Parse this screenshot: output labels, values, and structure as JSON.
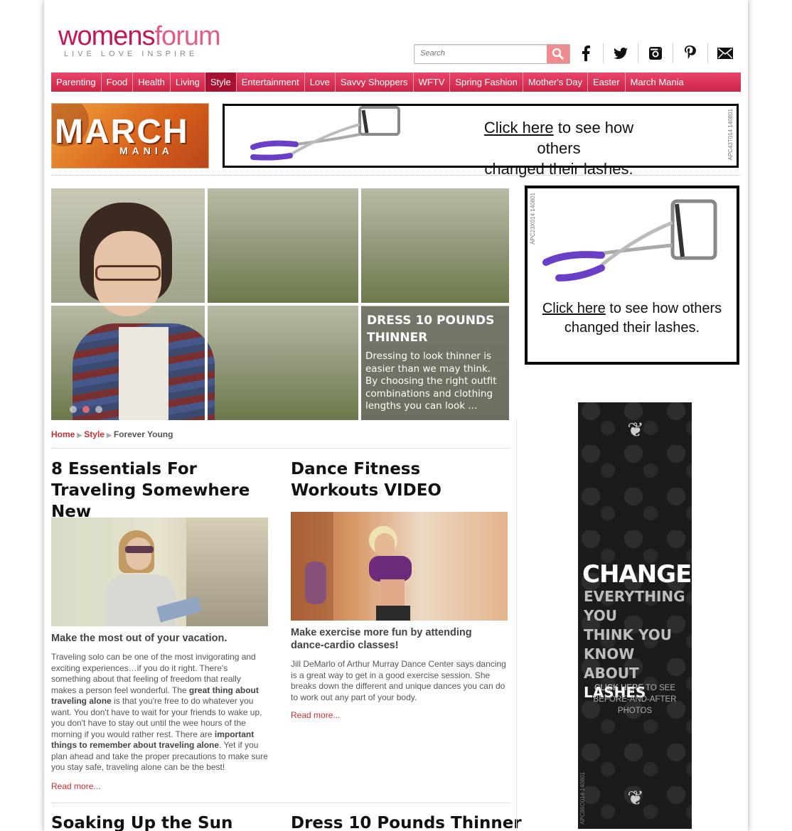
{
  "logo": {
    "word_a": "womens",
    "word_b": "forum",
    "tagline": "LIVE   LOVE   INSPIRE"
  },
  "search": {
    "placeholder": "Search"
  },
  "social": [
    "facebook-icon",
    "twitter-icon",
    "instagram-icon",
    "pinterest-icon",
    "email-icon"
  ],
  "nav": {
    "items": [
      "Parenting",
      "Food",
      "Health",
      "Living",
      "Style",
      "Entertainment",
      "Love",
      "Savvy Shoppers",
      "WFTV",
      "Spring Fashion",
      "Mother's Day",
      "Easter",
      "March Mania"
    ],
    "active": "Style"
  },
  "march_mania_banner": {
    "line1": "MARCH",
    "line2": "MANIA"
  },
  "top_ad": {
    "link": "Click here",
    "rest_line1": " to see how others",
    "line2": "changed their lashes.",
    "code": "APC43T014 140801"
  },
  "hero": {
    "title": "DRESS 10 POUNDS THINNER",
    "text": "Dressing to look thinner is easier than we may think. By choosing the right outfit combinations and clothing lengths you can look ...",
    "dots": 3,
    "active_dot": 2
  },
  "breadcrumb": {
    "home": "Home",
    "section": "Style",
    "current": "Forever Young"
  },
  "articles": [
    {
      "title": "8 Essentials For Traveling Somewhere New",
      "subtitle": "Make the most out of your vacation.",
      "body_1": "Traveling solo can be one of the most invigorating and exciting experiences…if you do it right. There's something about that feeling of freedom that really makes a person feel wonderful. The ",
      "bold_1": "great thing about traveling alone",
      "body_2": " is that you're free to do whatever you want. You don't have to wait for your friends to wake up, you don't have to stay out until the wee hours of the morning if you would rather rest. There are ",
      "bold_2": "important things to remember about traveling alone",
      "body_3": ". Yet if you plan ahead and take the proper precautions to make sure you stay safe, traveling alone can be the best!",
      "read_more": "Read more..."
    },
    {
      "title": "Dance Fitness Workouts VIDEO",
      "subtitle": "Make exercise more fun by attending dance-cardio classes!",
      "body": "Jill DeMarlo of Arthur Murray Dance Center says dancing is a great way to get in a good exercise session. She breaks down the different and unique dances you can do to work out any part of your body.",
      "read_more": "Read more..."
    },
    {
      "title": "Soaking Up the Sun"
    },
    {
      "title": "Dress 10 Pounds Thinner"
    }
  ],
  "side_ad_1": {
    "link": "Click here",
    "rest_line1": " to see how others",
    "line2": "changed their lashes.",
    "code": "APC23X014 140801"
  },
  "side_ad_2": {
    "headline": "CHANGE",
    "line1": "EVERYTHING YOU",
    "line2": "THINK YOU KNOW",
    "line3a": "ABOUT ",
    "line3b": "LASHES",
    "cta_a": "CLICK HERE",
    "cta_b": " TO SEE",
    "cta_c": "BEFORE-AND-AFTER PHOTOS",
    "code": "APC86O014 140801"
  },
  "colors": {
    "nav_red": "#e03a5e",
    "link_red": "#cc2d2d",
    "brand_pink": "#c2185b",
    "search_btn": "#f08a8f"
  }
}
